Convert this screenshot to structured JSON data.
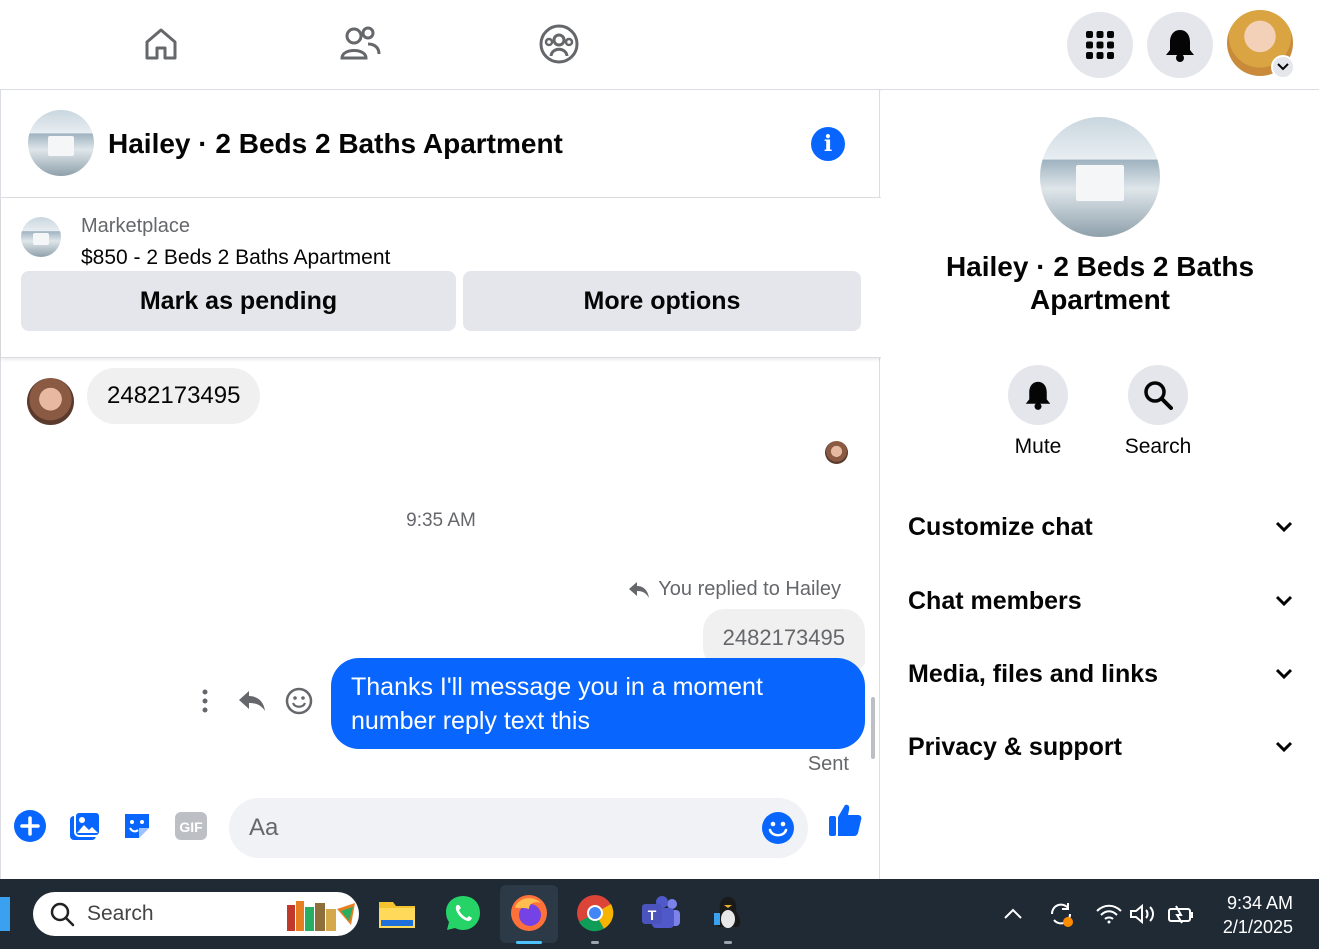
{
  "conversation": {
    "title": "Hailey · 2 Beds 2 Baths Apartment"
  },
  "marketplace": {
    "label": "Marketplace",
    "item": "$850 - 2 Beds 2 Baths Apartment",
    "mark_pending": "Mark as pending",
    "more_options": "More options"
  },
  "messages": {
    "incoming": "2482173495",
    "timestamp": "9:35 AM",
    "replied_label": "You replied to Hailey",
    "quoted": "2482173495",
    "outgoing": "Thanks I'll message you in a moment number reply text this",
    "status": "Sent"
  },
  "composer": {
    "placeholder": "Aa"
  },
  "details": {
    "name": "Hailey · 2 Beds 2 Baths Apartment",
    "mute": "Mute",
    "search": "Search",
    "sections": [
      "Customize chat",
      "Chat members",
      "Media, files and links",
      "Privacy & support"
    ]
  },
  "taskbar": {
    "search_placeholder": "Search",
    "time": "9:34 AM",
    "date": "2/1/2025"
  },
  "colors": {
    "accent": "#0866ff",
    "bubble_grey": "#f0f0f0",
    "button_grey": "#e4e6eb",
    "taskbar": "#1f2a35"
  }
}
